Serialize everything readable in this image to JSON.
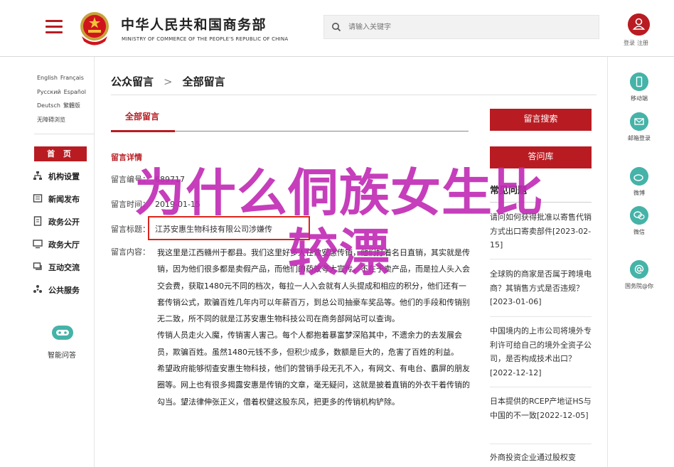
{
  "header": {
    "brand_cn": "中华人民共和国商务部",
    "brand_en": "MINISTRY OF COMMERCE OF THE PEOPLE'S REPUBLIC OF CHINA",
    "search_placeholder": "请输入关键字",
    "login": "登录",
    "register": "注册"
  },
  "languages": [
    "English",
    "Français",
    "Русский",
    "Español",
    "Deutsch",
    "繁體版",
    "无障碍浏览"
  ],
  "nav": {
    "home": "首 页",
    "items": [
      "机构设置",
      "新闻发布",
      "政务公开",
      "政务大厅",
      "互动交流",
      "公共服务"
    ],
    "assistant": "智能问答"
  },
  "breadcrumb": {
    "first": "公众留言",
    "separator": ">",
    "second": "全部留言"
  },
  "tab": {
    "label": "全部留言"
  },
  "detail": {
    "section_title": "留言详情",
    "number_label": "留言编号：",
    "number_value": "689717",
    "time_label": "留言时间：",
    "time_value": "2019-01-15",
    "subject_label": "留言标题：",
    "subject_value": "江苏安惠生物科技有限公司涉嫌传",
    "content_label": "留言内容：",
    "paragraphs": [
      "我这里是江西赣州于都县。我们这里好多人在做安惠传销，他们打着名日直销，其实就是传销，因为他们很多都是卖假产品，而他们的药效夸大宣传，不在于卖产品，而是拉人头入会交会费，获取1480元不同的档次，每拉一人入会就有人头提成和相应的积分，他们还有一套传销公式，欺骗百姓几年内可以年薪百万，到总公司抽豪车奖品等。他们的手段和传销别无二致，所不同的就是江苏安惠生物科技公司在商务部网站可以查询。",
      "传销人员走火入魔，传销害人害己。每个人都抱着暴富梦深陷其中，不遗余力的去发展会员，欺骗百姓。虽然1480元钱不多，但积少成多，数额是巨大的，危害了百姓的利益。",
      "希望政府能够彻查安惠生物科技，他们的营销手段无孔不入，有网文、有电台、霸屏的朋友圈等。网上也有很多揭露安惠是传销的文章，毫无疑问，这就是披着直销的外衣干着传销的勾当。望法律伸张正义，借着权健这股东风，把更多的传销机构铲除。"
    ]
  },
  "right": {
    "search_btn": "留言搜索",
    "faq_btn": "答问库",
    "faq_title": "常见问题",
    "questions": [
      {
        "text": "请问如何获得批准以寄售代销方式出口寄卖部件",
        "date": "[2023-02-15]"
      },
      {
        "text": "全球购的商家是否属于跨境电商？其销售方式是否违规？",
        "date": "[2023-01-06]"
      },
      {
        "text": "中国境内的上市公司将境外专利许可给自己的境外全资子公司，是否构成技术出口？",
        "date": "[2022-12-12]"
      },
      {
        "text": "日本提供的RCEP产地证HS与中国的不一致",
        "date": "[2022-12-05]"
      },
      {
        "text": "外商投资企业通过股权变"
      }
    ]
  },
  "side_tools": [
    "移动端",
    "邮箱登录",
    "微博",
    "微信",
    "国务院@你"
  ],
  "overlay": {
    "line1": "为什么侗族女生比",
    "line2": "较漂"
  },
  "colors": {
    "brand_red": "#b81c22",
    "teal": "#45b3a8",
    "overlay_magenta": "#c02ab4",
    "highlight_red": "#d8261c"
  }
}
